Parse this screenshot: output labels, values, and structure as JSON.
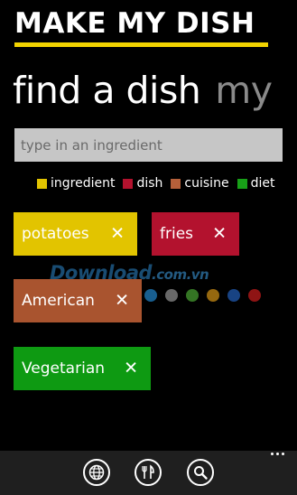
{
  "app": {
    "title": "MAKE MY DISH",
    "accent_color": "#f2d300"
  },
  "pivot": {
    "items": [
      {
        "label": "find a dish",
        "active": true
      },
      {
        "label": "my",
        "active": false
      }
    ]
  },
  "search": {
    "placeholder": "type in an ingredient",
    "value": ""
  },
  "legend": [
    {
      "label": "ingredient",
      "color": "#e2c400"
    },
    {
      "label": "dish",
      "color": "#b3122e"
    },
    {
      "label": "cuisine",
      "color": "#b5603a"
    },
    {
      "label": "diet",
      "color": "#18a018"
    }
  ],
  "tags": [
    {
      "label": "potatoes",
      "type": "ingredient",
      "color": "#e2c400",
      "remove_icon": "close-icon",
      "remove_glyph": "✕"
    },
    {
      "label": "fries",
      "type": "dish",
      "color": "#b3122e",
      "remove_icon": "close-icon",
      "remove_glyph": "✕"
    },
    {
      "label": "American",
      "type": "cuisine",
      "color": "#a9542f",
      "remove_icon": "close-icon",
      "remove_glyph": "✕"
    },
    {
      "label": "Vegetarian",
      "type": "diet",
      "color": "#0e9a12",
      "remove_icon": "close-icon",
      "remove_glyph": "✕"
    }
  ],
  "watermark": {
    "text_main": "Download",
    "text_small": ".com.vn",
    "dot_colors": [
      "#1c6fa8",
      "#7a7a7a",
      "#3d8a2a",
      "#b07a12",
      "#1c4f9a",
      "#a81818"
    ]
  },
  "app_bar": {
    "background": "#1f1f1f",
    "buttons": [
      {
        "icon": "globe-icon"
      },
      {
        "icon": "fork-knife-icon"
      },
      {
        "icon": "search-icon"
      }
    ],
    "more_icon": "more-icon"
  }
}
